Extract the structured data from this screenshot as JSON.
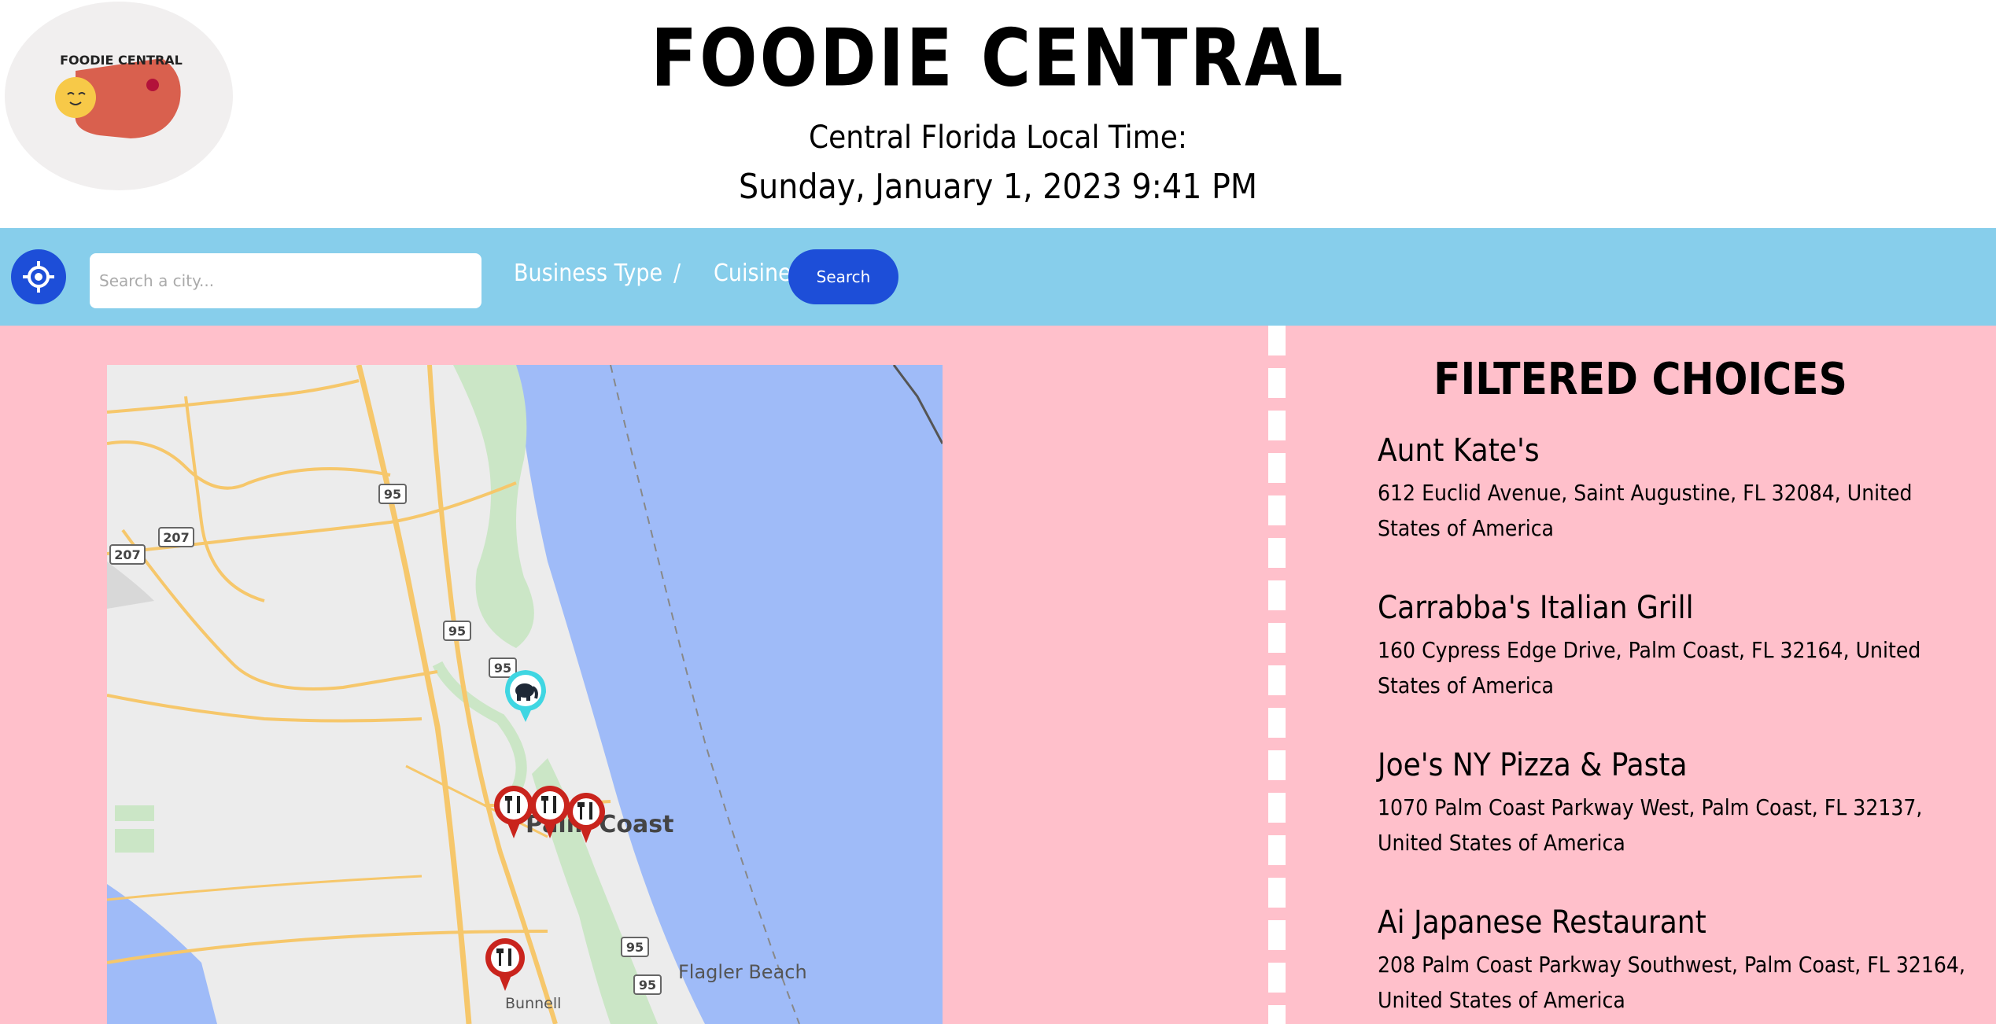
{
  "header": {
    "logo_text": "FOODIE CENTRAL",
    "title": "FOODIE CENTRAL",
    "time_label": "Central Florida Local Time:",
    "time_value": "Sunday, January 1, 2023 9:41 PM"
  },
  "toolbar": {
    "locate_icon": "crosshair-icon",
    "search_placeholder": "Search a city...",
    "business_type": "Business Type",
    "separator": "/",
    "cuisine": "Cuisine",
    "search_label": "Search"
  },
  "map": {
    "labels": {
      "palm_coast": "Palm Coast",
      "flagler_beach": "Flagler Beach",
      "bunnell": "Bunnell"
    },
    "shields": [
      "95",
      "207",
      "207",
      "95",
      "95",
      "95",
      "95"
    ],
    "colors": {
      "land": "#ececec",
      "water": "#9fbbf8",
      "park": "#cbe6c6",
      "road": "#f6c76b"
    },
    "markers": [
      {
        "type": "attraction",
        "icon": "elephant-icon",
        "color": "#3fd6e2"
      },
      {
        "type": "restaurant",
        "icon": "fork-knife-icon",
        "color": "#c9241d"
      },
      {
        "type": "restaurant",
        "icon": "fork-knife-icon",
        "color": "#c9241d"
      },
      {
        "type": "restaurant",
        "icon": "fork-knife-icon",
        "color": "#c9241d"
      },
      {
        "type": "restaurant",
        "icon": "fork-knife-icon",
        "color": "#c9241d"
      }
    ]
  },
  "choices": {
    "title": "FILTERED CHOICES",
    "items": [
      {
        "name": "Aunt Kate's",
        "address": "612 Euclid Avenue, Saint Augustine, FL 32084, United States of America"
      },
      {
        "name": "Carrabba's Italian Grill",
        "address": "160 Cypress Edge Drive, Palm Coast, FL 32164, United States of America"
      },
      {
        "name": "Joe's NY Pizza & Pasta",
        "address": "1070 Palm Coast Parkway West, Palm Coast, FL 32137, United States of America"
      },
      {
        "name": "Ai Japanese Restaurant",
        "address": "208 Palm Coast Parkway Southwest, Palm Coast, FL 32164, United States of America"
      }
    ]
  },
  "colors": {
    "toolbar": "#87ceeb",
    "content": "#ffc0cb",
    "button": "#1d4ed8"
  }
}
